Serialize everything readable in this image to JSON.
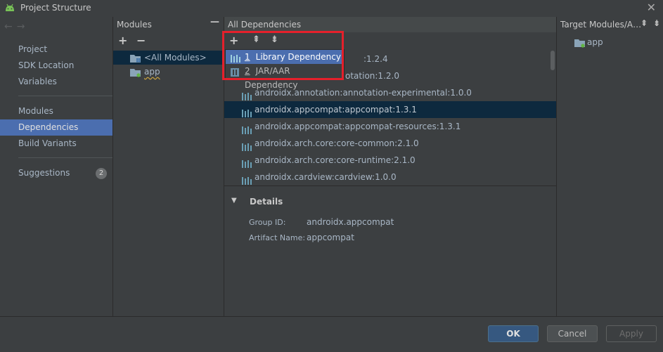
{
  "window": {
    "title": "Project Structure",
    "close_glyph": "✕"
  },
  "nav": {
    "back_glyph": "←",
    "forward_glyph": "→"
  },
  "sidebar": {
    "items": [
      {
        "label": "Project"
      },
      {
        "label": "SDK Location"
      },
      {
        "label": "Variables"
      },
      {
        "label": "Modules"
      },
      {
        "label": "Dependencies",
        "selected": true
      },
      {
        "label": "Build Variants"
      },
      {
        "label": "Suggestions",
        "badge": "2"
      }
    ]
  },
  "modules_panel": {
    "header": "Modules",
    "collapse_glyph": "—",
    "add_glyph": "+",
    "remove_glyph": "−",
    "items": [
      {
        "label": "<All Modules>",
        "selected": true
      },
      {
        "label": "app"
      }
    ]
  },
  "deps_panel": {
    "header": "All Dependencies",
    "toolbar": {
      "add_glyph": "+",
      "expand_glyph": "⇞",
      "collapse_glyph": "⇟"
    },
    "rows": [
      {
        "label": ":1.2.4"
      },
      {
        "label": "otation:1.2.0"
      },
      {
        "label": "androidx.annotation:annotation-experimental:1.0.0"
      },
      {
        "label": "androidx.appcompat:appcompat:1.3.1",
        "selected": true
      },
      {
        "label": "androidx.appcompat:appcompat-resources:1.3.1"
      },
      {
        "label": "androidx.arch.core:core-common:2.1.0"
      },
      {
        "label": "androidx.arch.core:core-runtime:2.1.0"
      },
      {
        "label": "androidx.cardview:cardview:1.0.0"
      }
    ],
    "popup": [
      {
        "num": "1",
        "label": "Library Dependency",
        "selected": true
      },
      {
        "num": "2",
        "label": "JAR/AAR Dependency"
      }
    ],
    "details": {
      "title": "Details",
      "fields": [
        {
          "label": "Group ID:",
          "value": "androidx.appcompat"
        },
        {
          "label": "Artifact Name:",
          "value": "appcompat"
        }
      ]
    }
  },
  "target_panel": {
    "header": "Target Modules/A…",
    "items": [
      {
        "label": "app"
      }
    ]
  },
  "footer": {
    "ok_label": "OK",
    "cancel_label": "Cancel",
    "apply_label": "Apply"
  },
  "colors": {
    "background": "#3c3f41",
    "selection": "#4b6eaf",
    "row_selection": "#0d293e",
    "highlight_box": "#e5202b",
    "library_icon": "#6a9fb5"
  }
}
